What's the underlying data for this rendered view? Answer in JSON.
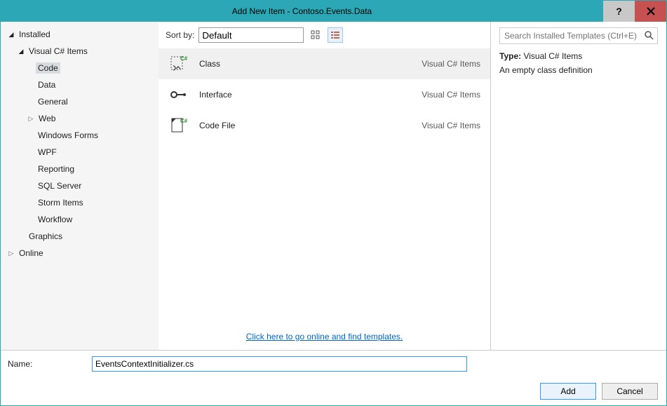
{
  "title": "Add New Item - Contoso.Events.Data",
  "tree": {
    "installed": "Installed",
    "csharp": "Visual C# Items",
    "code": "Code",
    "data": "Data",
    "general": "General",
    "web": "Web",
    "winforms": "Windows Forms",
    "wpf": "WPF",
    "reporting": "Reporting",
    "sql": "SQL Server",
    "storm": "Storm Items",
    "workflow": "Workflow",
    "graphics": "Graphics",
    "online": "Online"
  },
  "sort_label": "Sort by:",
  "sort_value": "Default",
  "templates": [
    {
      "name": "Class",
      "category": "Visual C# Items"
    },
    {
      "name": "Interface",
      "category": "Visual C# Items"
    },
    {
      "name": "Code File",
      "category": "Visual C# Items"
    }
  ],
  "online_link": "Click here to go online and find templates.",
  "search_placeholder": "Search Installed Templates (Ctrl+E)",
  "details": {
    "type_label": "Type:",
    "type_value": "Visual C# Items",
    "description": "An empty class definition"
  },
  "name_label": "Name:",
  "name_value": "EventsContextInitializer.cs",
  "add_button": "Add",
  "cancel_button": "Cancel"
}
